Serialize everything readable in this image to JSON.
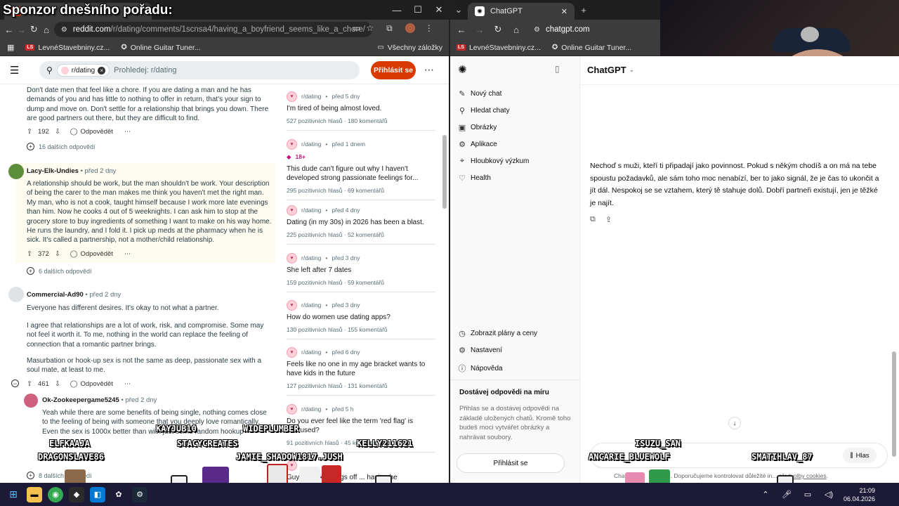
{
  "overlay": {
    "sponsor_title": "Sponzor dnešního pořadu:",
    "nicks": [
      "KAYJUB10",
      "WIDEPLUMBER",
      "ELFKAAJA",
      "STACYCREATES",
      "KELLY211621",
      "DRAGONSLAVE86",
      "JAMIE_SHADOW1817.JUSH",
      "ISUZU_SAN",
      "ANCARIE_BLUEWOLF",
      "SMATIHLAV_87"
    ]
  },
  "left_browser": {
    "url_host": "reddit.com",
    "url_path": "/r/dating/comments/1scnsa4/having_a_boyfriend_seems_like_a_chore/",
    "bookmarks": [
      "LevnéStavebniny.cz...",
      "Online Guitar Tuner...",
      "Všechny záložky"
    ]
  },
  "reddit": {
    "search_chip": "r/dating",
    "search_placeholder": "Prohledej: r/dating",
    "login": "Přihlásit se",
    "reply": "Odpovědět",
    "comments": [
      {
        "text": "Don't date men that feel like a chore. If you are dating a man and he has demands of you and has little to nothing to offer in return, that's your sign to dump and move on. Don't settle for a relationship that brings you down. There are good partners out there, but they are difficult to find.",
        "votes": "192",
        "more": "16 dalších odpovědí"
      },
      {
        "user": "Lacy-Elk-Undies",
        "time": "před 2 dny",
        "text": "A relationship should be work, but the man shouldn't be work. Your description of being the carer to the man makes me think you haven't met the right man. My man, who is not a cook, taught himself because I work more late evenings than him. Now he cooks 4 out of 5 weeknights. I can ask him to stop at the grocery store to buy ingredients of something I want to make on his way home. He runs the laundry, and I fold it. I pick up meds at the pharmacy when he is sick. It's called a partnership, not a mother/child relationship.",
        "votes": "372",
        "more": "6 dalších odpovědí"
      },
      {
        "user": "Commercial-Ad90",
        "time": "před 2 dny",
        "p1": "Everyone has different desires. It's okay to not what a partner.",
        "p2": "I agree that relationships are a lot of work, risk, and compromise. Some may not feel it worth it. To me, nothing in the world can replace the feeling of connection that a romantic partner brings.",
        "p3": "Masurbation or hook-up sex is not the same as deep, passionate sex with a soul mate, at least to me.",
        "votes": "461"
      },
      {
        "user": "Ok-Zookeepergame5245",
        "time": "před 2 dny",
        "text": "Yeah while there are some benefits of being single, nothing comes close to the feeling of being with someone that you deeply love romantically. Even the sex is 1000x better than with just some random hookup",
        "more": "8 dalších odpovědí"
      }
    ],
    "related": [
      {
        "sub": "r/dating",
        "time": "před 5 dny",
        "title": "I'm tired of being almost loved.",
        "votes": "527 pozitivních hlasů",
        "comments": "180 komentářů"
      },
      {
        "sub": "r/dating",
        "time": "před 1 dnem",
        "nsfw": "18+",
        "title": "This dude can't figure out why I haven't developed strong passionate feelings for...",
        "votes": "295 pozitivních hlasů",
        "comments": "69 komentářů"
      },
      {
        "sub": "r/dating",
        "time": "před 4 dny",
        "title": "Dating (in my 30s) in 2026 has been a blast.",
        "votes": "225 pozitivních hlasů",
        "comments": "52 komentářů"
      },
      {
        "sub": "r/dating",
        "time": "před 3 dny",
        "title": "She left after 7 dates",
        "votes": "159 pozitivních hlasů",
        "comments": "59 komentářů"
      },
      {
        "sub": "r/dating",
        "time": "před 3 dny",
        "title": "How do women use dating apps?",
        "votes": "130 pozitivních hlasů",
        "comments": "155 komentářů"
      },
      {
        "sub": "r/dating",
        "time": "před 6 dny",
        "title": "Feels like no one in my age bracket wants to have kids in the future",
        "votes": "127 pozitivních hlasů",
        "comments": "131 komentářů"
      },
      {
        "sub": "r/dating",
        "time": "před 5 h",
        "title": "Do you ever feel like the term 'red flag' is overused?",
        "votes": "91 pozitivních hlasů",
        "comments": "45 komentářů"
      }
    ],
    "partial_post": "Guy ... broke things off ... having he"
  },
  "right_browser": {
    "tab": "ChatGPT",
    "url": "chatgpt.com",
    "bookmarks": [
      "LevnéStavebniny.cz...",
      "Online Guitar Tuner..."
    ]
  },
  "chatgpt": {
    "brand": "ChatGPT",
    "menu": [
      "Nový chat",
      "Hledat chaty",
      "Obrázky",
      "Aplikace",
      "Hloubkový výzkum",
      "Health"
    ],
    "bottom_menu": [
      "Zobrazit plány a ceny",
      "Nastavení",
      "Nápověda"
    ],
    "promo_title": "Dostávej odpovědi na míru",
    "promo_text": "Přihlas se a dostávej odpovědi na základě uložených chatů. Kromě toho budeš moci vytvářet obrázky a nahrávat soubory.",
    "login": "Přihlásit se",
    "answer": "Nechoď s muži, kteří ti připadají jako povinnost. Pokud s někým chodíš a on má na tebe spoustu požadavků, ale sám toho moc nenabízí, ber to jako signál, že je čas to ukončit a jít dál. Nespokoj se se vztahem, který tě stahuje dolů. Dobří partneři existují, jen je těžké je najít.",
    "voice": "Hlas",
    "footer_left": "Chat",
    "footer_mid": "... Doporučujeme kontrolovat důležité in...",
    "footer_link": "předvolby cookies",
    "footer_end": "."
  },
  "taskbar": {
    "time": "21:09",
    "date": "06.04.2026"
  },
  "colors": {
    "reddit_orange": "#d93a00",
    "taskbar": "#1c1a36"
  }
}
